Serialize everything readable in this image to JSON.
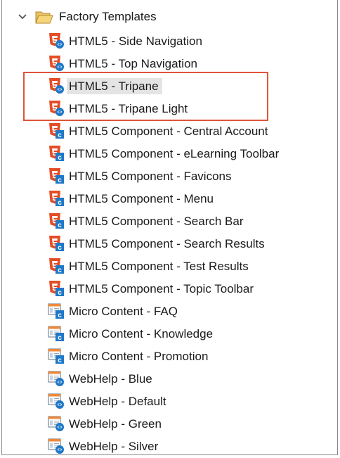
{
  "tree": {
    "root": {
      "label": "Factory Templates",
      "icon": "folder-open-icon",
      "expanded": true
    },
    "items": [
      {
        "label": "HTML5 - Side Navigation",
        "kind": "html5"
      },
      {
        "label": "HTML5 - Top Navigation",
        "kind": "html5"
      },
      {
        "label": "HTML5 - Tripane",
        "kind": "html5",
        "selected": true
      },
      {
        "label": "HTML5 - Tripane Light",
        "kind": "html5"
      },
      {
        "label": "HTML5 Component - Central Account",
        "kind": "html5-component"
      },
      {
        "label": "HTML5 Component - eLearning Toolbar",
        "kind": "html5-component"
      },
      {
        "label": "HTML5 Component - Favicons",
        "kind": "html5-component"
      },
      {
        "label": "HTML5 Component - Menu",
        "kind": "html5-component"
      },
      {
        "label": "HTML5 Component - Search Bar",
        "kind": "html5-component"
      },
      {
        "label": "HTML5 Component - Search Results",
        "kind": "html5-component"
      },
      {
        "label": "HTML5 Component - Test Results",
        "kind": "html5-component"
      },
      {
        "label": "HTML5 Component - Topic Toolbar",
        "kind": "html5-component"
      },
      {
        "label": "Micro Content - FAQ",
        "kind": "micro-content"
      },
      {
        "label": "Micro Content - Knowledge",
        "kind": "micro-content"
      },
      {
        "label": "Micro Content - Promotion",
        "kind": "micro-content"
      },
      {
        "label": "WebHelp - Blue",
        "kind": "webhelp"
      },
      {
        "label": "WebHelp - Default",
        "kind": "webhelp"
      },
      {
        "label": "WebHelp - Green",
        "kind": "webhelp"
      },
      {
        "label": "WebHelp - Silver",
        "kind": "webhelp"
      }
    ]
  },
  "colors": {
    "html5_orange": "#e44d26",
    "badge_blue": "#1f78c8",
    "webhelp_gray": "#7c8a99",
    "highlight_red": "#e0533a",
    "selection_gray": "#e4e4e4"
  }
}
